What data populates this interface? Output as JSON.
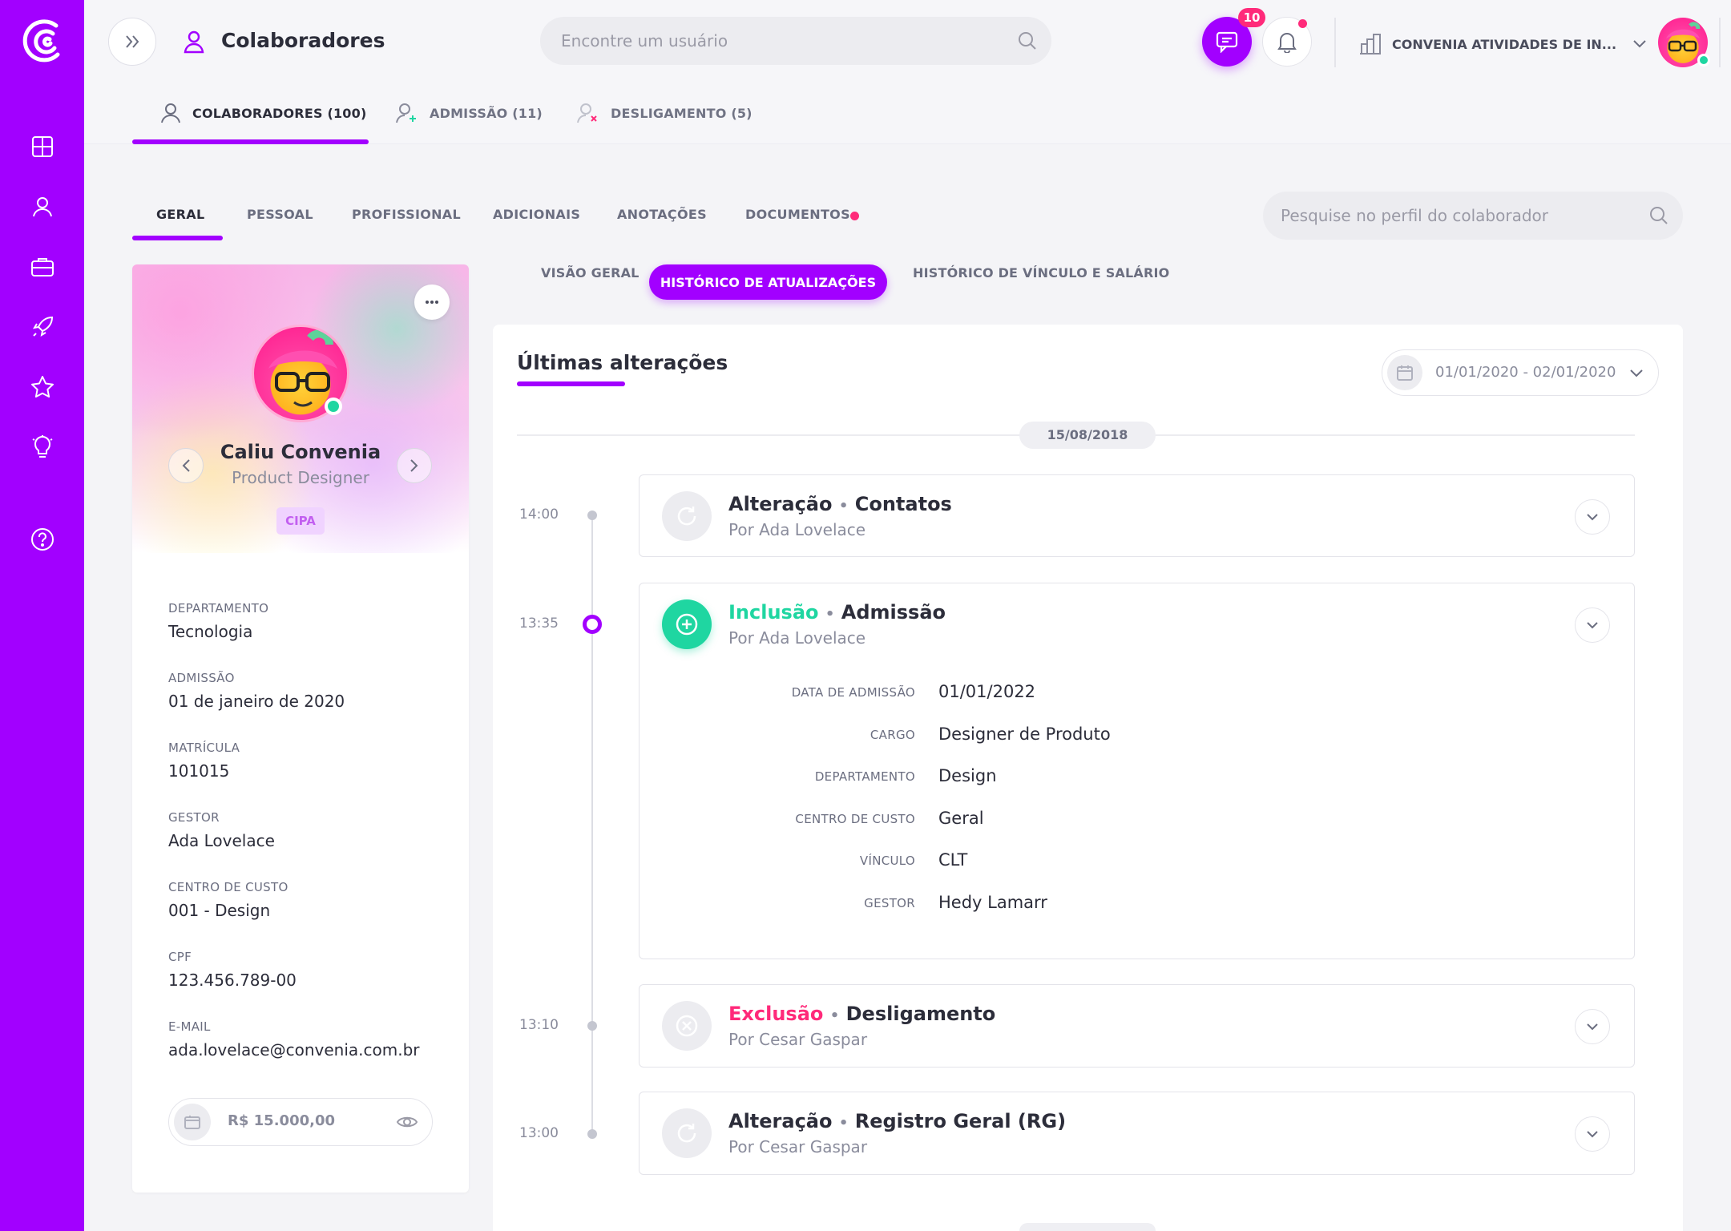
{
  "colors": {
    "accent": "#a200ff",
    "success": "#1fd6a1",
    "danger": "#ff2a7a",
    "muted": "#8a8c9c"
  },
  "header": {
    "page_title": "Colaboradores",
    "search_placeholder": "Encontre um usuário",
    "chat_badge": "10",
    "company": "CONVENIA ATIVIDADES DE IN..."
  },
  "top_tabs": [
    {
      "label": "COLABORADORES (100)"
    },
    {
      "label": "ADMISSÃO (11)"
    },
    {
      "label": "DESLIGAMENTO (5)"
    }
  ],
  "profile_tabs": [
    {
      "label": "GERAL"
    },
    {
      "label": "PESSOAL"
    },
    {
      "label": "PROFISSIONAL"
    },
    {
      "label": "ADICIONAIS"
    },
    {
      "label": "ANOTAÇÕES"
    },
    {
      "label": "DOCUMENTOS"
    }
  ],
  "profile_search_placeholder": "Pesquise no perfil do colaborador",
  "profile": {
    "name": "Caliu Convenia",
    "role": "Product Designer",
    "badge": "CIPA",
    "fields": [
      {
        "label": "DEPARTAMENTO",
        "value": "Tecnologia"
      },
      {
        "label": "ADMISSÃO",
        "value": "01 de janeiro de 2020"
      },
      {
        "label": "MATRÍCULA",
        "value": "101015"
      },
      {
        "label": "GESTOR",
        "value": "Ada Lovelace"
      },
      {
        "label": "CENTRO DE CUSTO",
        "value": "001 - Design"
      },
      {
        "label": "CPF",
        "value": "123.456.789-00"
      },
      {
        "label": "E-MAIL",
        "value": "ada.lovelace@convenia.com.br"
      }
    ],
    "salary": "R$ 15.000,00"
  },
  "view_tabs": [
    {
      "label": "VISÃO GERAL"
    },
    {
      "label": "HISTÓRICO DE ATUALIZAÇÕES"
    },
    {
      "label": "HISTÓRICO DE VÍNCULO E SALÁRIO"
    }
  ],
  "history": {
    "title": "Últimas alterações",
    "date_range": "01/01/2020 - 02/01/2020",
    "date_chip": "15/08/2018",
    "separator": "•",
    "events": [
      {
        "time": "14:00",
        "type": "Alteração",
        "subject": "Contatos",
        "author": "Por Ada Lovelace"
      },
      {
        "time": "13:35",
        "type": "Inclusão",
        "subject": "Admissão",
        "author": "Por Ada Lovelace"
      },
      {
        "time": "13:10",
        "type": "Exclusão",
        "subject": "Desligamento",
        "author": "Por Cesar Gaspar"
      },
      {
        "time": "13:00",
        "type": "Alteração",
        "subject": "Registro Geral (RG)",
        "author": "Por Cesar Gaspar"
      }
    ],
    "details": [
      {
        "label": "DATA DE ADMISSÃO",
        "value": "01/01/2022"
      },
      {
        "label": "CARGO",
        "value": "Designer de Produto"
      },
      {
        "label": "DEPARTAMENTO",
        "value": "Design"
      },
      {
        "label": "CENTRO DE CUSTO",
        "value": "Geral"
      },
      {
        "label": "VÍNCULO",
        "value": "CLT"
      },
      {
        "label": "GESTOR",
        "value": "Hedy Lamarr"
      }
    ]
  }
}
